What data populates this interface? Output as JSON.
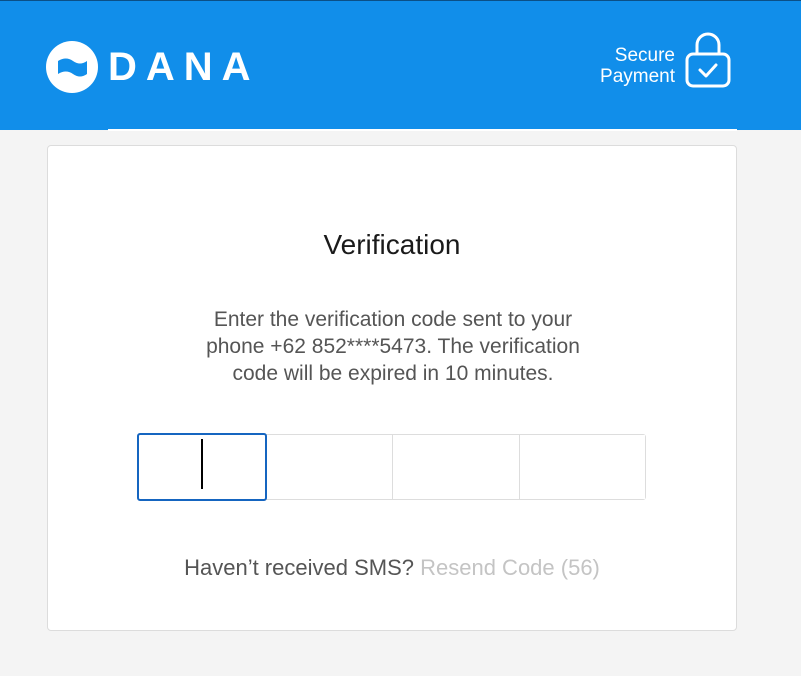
{
  "header": {
    "brand": "DANA",
    "secure_line1": "Secure",
    "secure_line2": "Payment",
    "bg_color": "#118eea"
  },
  "verification": {
    "title": "Verification",
    "description": "Enter the verification code sent to your phone +62 852****5473. The verification code will be expired in 10 minutes.",
    "code_digits": [
      "",
      "",
      "",
      ""
    ],
    "active_index": 0,
    "resend_question": "Haven’t received SMS?",
    "resend_link": "Resend Code (56)"
  },
  "icons": {
    "logo": "dana-logo-icon",
    "lock": "lock-check-icon"
  }
}
